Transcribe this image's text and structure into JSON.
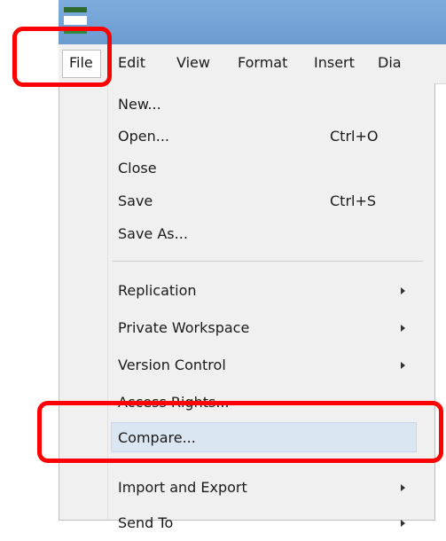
{
  "menubar": {
    "items": [
      "File",
      "Edit",
      "View",
      "Format",
      "Insert",
      "Dia"
    ]
  },
  "file_menu": {
    "items": [
      {
        "label": "New...",
        "shortcut": "",
        "submenu": false
      },
      {
        "label": "Open...",
        "shortcut": "Ctrl+O",
        "submenu": false
      },
      {
        "label": "Close",
        "shortcut": "",
        "submenu": false
      },
      {
        "label": "Save",
        "shortcut": "Ctrl+S",
        "submenu": false
      },
      {
        "label": "Save As...",
        "shortcut": "",
        "submenu": false
      },
      {
        "label": "Replication",
        "shortcut": "",
        "submenu": true
      },
      {
        "label": "Private Workspace",
        "shortcut": "",
        "submenu": true
      },
      {
        "label": "Version Control",
        "shortcut": "",
        "submenu": true
      },
      {
        "label": "Access Rights...",
        "shortcut": "",
        "submenu": false
      },
      {
        "label": "Compare...",
        "shortcut": "",
        "submenu": false
      },
      {
        "label": "Import and Export",
        "shortcut": "",
        "submenu": true
      },
      {
        "label": "Send To",
        "shortcut": "",
        "submenu": true
      }
    ],
    "highlighted": "Compare..."
  },
  "colors": {
    "callout": "#ff0000",
    "highlight": "#dbe6f3",
    "titlebar": "#6b9bd1"
  }
}
